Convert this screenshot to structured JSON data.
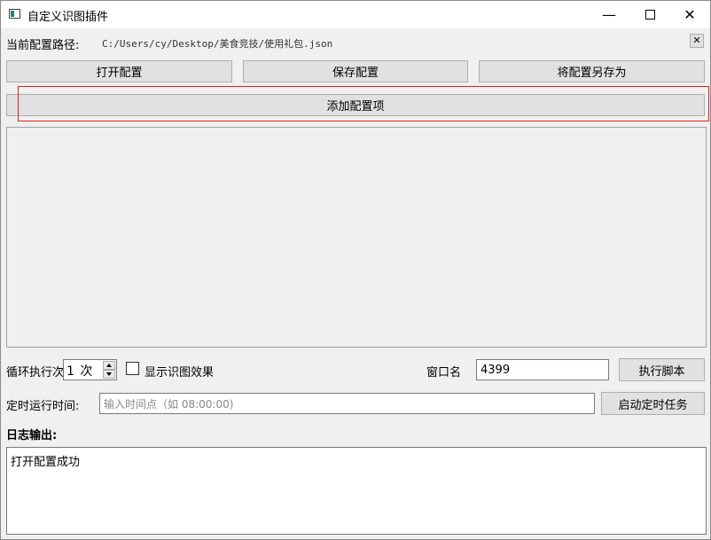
{
  "window": {
    "title": "自定义识图插件",
    "controls": {
      "minimize": "—",
      "close": "✕"
    }
  },
  "config_path": {
    "label": "当前配置路径:",
    "value": "C:/Users/cy/Desktop/美食竞技/使用礼包.json",
    "clear_glyph": "✕"
  },
  "toolbar": {
    "open_label": "打开配置",
    "save_label": "保存配置",
    "save_as_label": "将配置另存为",
    "add_item_label": "添加配置项"
  },
  "loop": {
    "label": "循环执行次",
    "count_value": "1 次"
  },
  "show_effect": {
    "label": "显示识图效果",
    "checked": false
  },
  "window_name": {
    "label": "窗口名",
    "value": "4399"
  },
  "run_script_label": "执行脚本",
  "schedule": {
    "label": "定时运行时间:",
    "placeholder": "输入时间点（如 08:00:00)",
    "start_label": "启动定时任务"
  },
  "log": {
    "label": "日志输出:",
    "lines": [
      "打开配置成功"
    ]
  },
  "colors": {
    "highlight_frame": "#e02020",
    "button_face": "#e1e1e1",
    "window_bg": "#f0f0f0"
  }
}
